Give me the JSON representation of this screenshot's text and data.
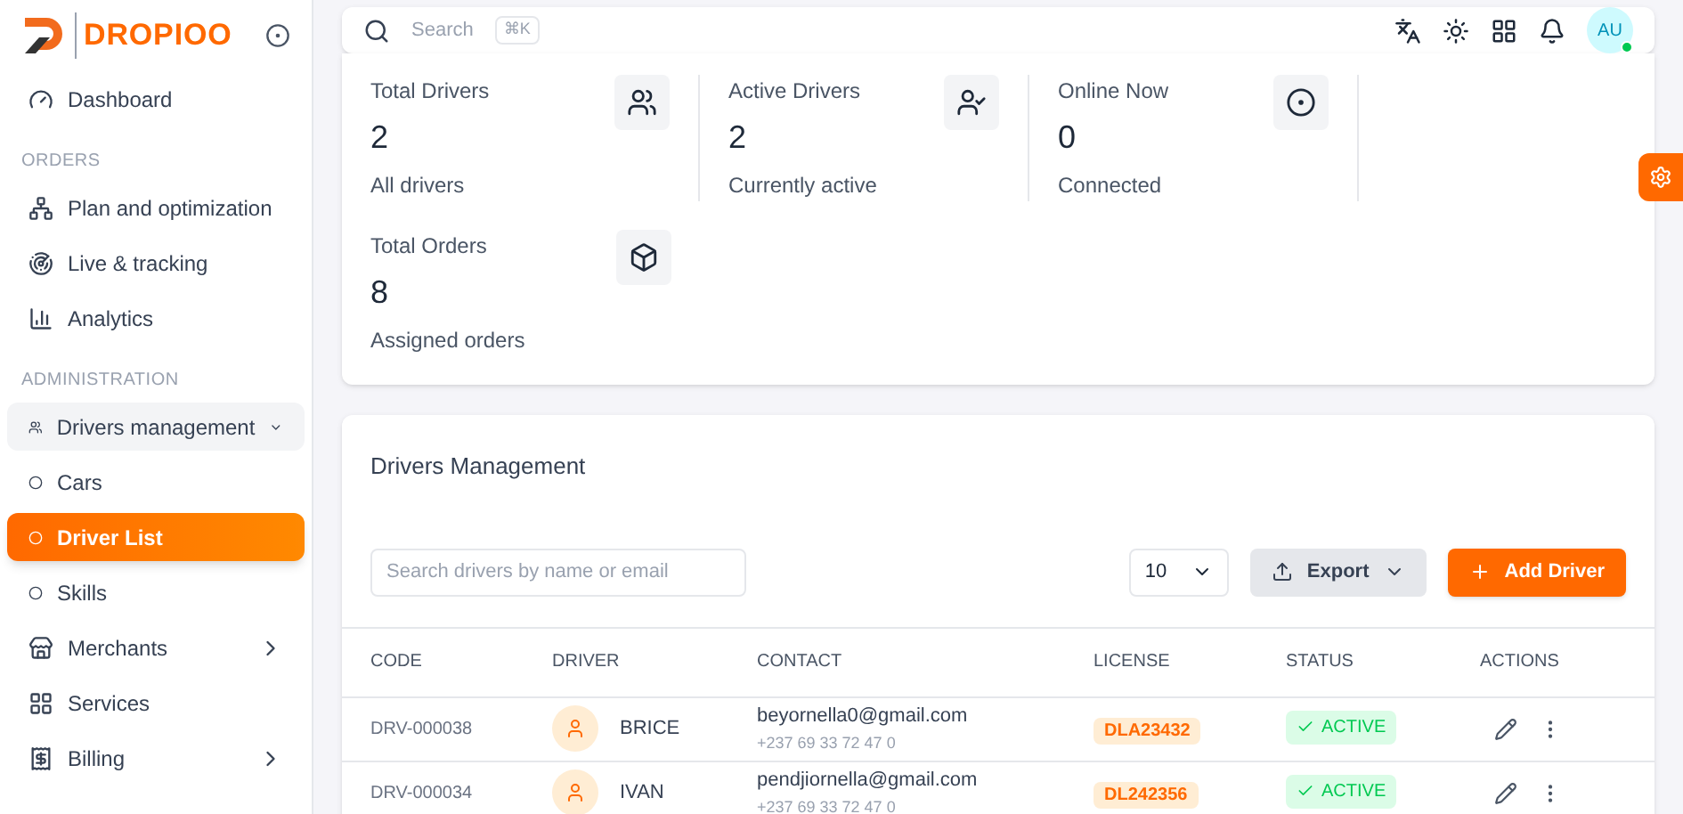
{
  "brand": {
    "name": "DROPIOO"
  },
  "sidebar": {
    "items": [
      {
        "kind": "item",
        "label": "Dashboard",
        "selected": false
      },
      {
        "kind": "section",
        "label": "ORDERS"
      },
      {
        "kind": "item",
        "label": "Plan and optimization",
        "selected": false
      },
      {
        "kind": "item",
        "label": "Live & tracking",
        "selected": false
      },
      {
        "kind": "item",
        "label": "Analytics",
        "selected": false
      },
      {
        "kind": "section",
        "label": "ADMINISTRATION"
      },
      {
        "kind": "item",
        "label": "Drivers management",
        "selected": false,
        "expanded": true,
        "children": [
          {
            "label": "Cars",
            "selected": false
          },
          {
            "label": "Driver List",
            "selected": true
          },
          {
            "label": "Skills",
            "selected": false
          }
        ]
      },
      {
        "kind": "item",
        "label": "Merchants",
        "selected": false,
        "expanded": false
      },
      {
        "kind": "item",
        "label": "Services",
        "selected": false
      },
      {
        "kind": "item",
        "label": "Billing",
        "selected": false,
        "expanded": false
      }
    ]
  },
  "topbar": {
    "search_placeholder": "Search",
    "shortcut": "⌘K",
    "avatar": "AU",
    "online": true
  },
  "stats": [
    {
      "title": "Total Drivers",
      "value": "2",
      "caption": "All drivers"
    },
    {
      "title": "Active Drivers",
      "value": "2",
      "caption": "Currently active"
    },
    {
      "title": "Online Now",
      "value": "0",
      "caption": "Connected"
    },
    {
      "title": "Total Orders",
      "value": "8",
      "caption": "Assigned orders"
    }
  ],
  "drivers": {
    "title": "Drivers Management",
    "search_placeholder": "Search drivers by name or email",
    "page_size": "10",
    "export": "Export",
    "add": "Add Driver",
    "columns": [
      "CODE",
      "DRIVER",
      "CONTACT",
      "LICENSE",
      "STATUS",
      "ACTIONS"
    ],
    "rows": [
      {
        "code": "DRV-000038",
        "name": "BRICE",
        "email": "beyornella0@gmail.com",
        "phone": "+237 69 33 72 47 0",
        "license": "DLA23432",
        "status": "ACTIVE",
        "active": true
      },
      {
        "code": "DRV-000034",
        "name": "IVAN",
        "email": "pendjiornella@gmail.com",
        "phone": "+237 69 33 72 47 0",
        "license": "DL242356",
        "status": "ACTIVE",
        "active": true
      }
    ]
  }
}
